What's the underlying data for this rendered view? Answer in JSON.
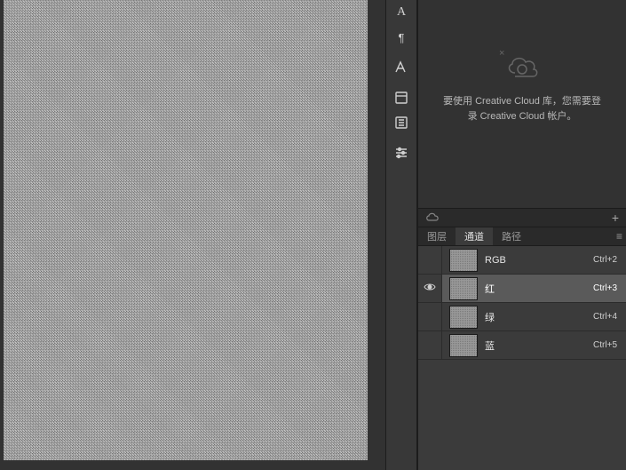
{
  "cc_panel": {
    "message_line1": "要使用 Creative Cloud 库，您需要登",
    "message_line2": "录 Creative Cloud 帐户。"
  },
  "panel": {
    "tabs": {
      "layers": "图层",
      "channels": "通道",
      "paths": "路径"
    }
  },
  "channels": [
    {
      "name": "RGB",
      "shortcut": "Ctrl+2",
      "visible": false,
      "selected": false
    },
    {
      "name": "红",
      "shortcut": "Ctrl+3",
      "visible": true,
      "selected": true
    },
    {
      "name": "绿",
      "shortcut": "Ctrl+4",
      "visible": false,
      "selected": false
    },
    {
      "name": "蓝",
      "shortcut": "Ctrl+5",
      "visible": false,
      "selected": false
    }
  ],
  "icons": {
    "plus": "+",
    "menu": "≡"
  }
}
